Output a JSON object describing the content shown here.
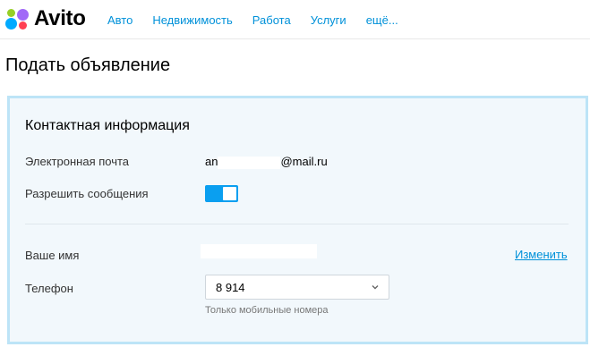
{
  "header": {
    "logo_text": "Avito",
    "nav": [
      "Авто",
      "Недвижимость",
      "Работа",
      "Услуги",
      "ещё..."
    ]
  },
  "page": {
    "title": "Подать объявление"
  },
  "contact": {
    "section_title": "Контактная информация",
    "email_label": "Электронная почта",
    "email_prefix": "an",
    "email_suffix": "@mail.ru",
    "messages_label": "Разрешить сообщения",
    "messages_enabled": true,
    "name_label": "Ваше имя",
    "change_link": "Изменить",
    "phone_label": "Телефон",
    "phone_value": "8 914",
    "phone_hint": "Только мобильные номера"
  },
  "colors": {
    "link": "#0091d9",
    "toggle_on": "#0a9ff0",
    "panel_bg": "#f2f8fc",
    "panel_border": "#bde4f7"
  },
  "icons": {
    "logo": "avito-dots-icon",
    "select_arrow": "chevron-down-icon"
  }
}
